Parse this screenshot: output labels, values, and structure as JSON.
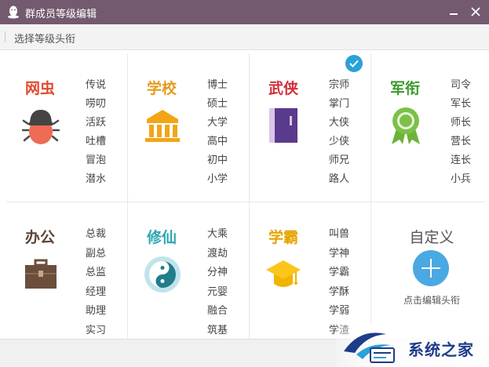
{
  "window": {
    "title": "群成员等级编辑"
  },
  "toolbar": {
    "hint": "选择等级头衔"
  },
  "categories": [
    {
      "name": "网虫",
      "color": "#e04a30",
      "ranks": [
        "传说",
        "唠叨",
        "活跃",
        "吐槽",
        "冒泡",
        "潜水"
      ],
      "selected": false
    },
    {
      "name": "学校",
      "color": "#e69a1c",
      "ranks": [
        "博士",
        "硕士",
        "大学",
        "高中",
        "初中",
        "小学"
      ],
      "selected": false
    },
    {
      "name": "武侠",
      "color": "#d02f3a",
      "ranks": [
        "宗师",
        "掌门",
        "大侠",
        "少侠",
        "师兄",
        "路人"
      ],
      "selected": true
    },
    {
      "name": "军衔",
      "color": "#3a9b2e",
      "ranks": [
        "司令",
        "军长",
        "师长",
        "营长",
        "连长",
        "小兵"
      ],
      "selected": false
    },
    {
      "name": "办公",
      "color": "#5b4436",
      "ranks": [
        "总裁",
        "副总",
        "总监",
        "经理",
        "助理",
        "实习"
      ],
      "selected": false
    },
    {
      "name": "修仙",
      "color": "#2fa6b4",
      "ranks": [
        "大乘",
        "渡劫",
        "分神",
        "元婴",
        "融合",
        "筑基"
      ],
      "selected": false
    },
    {
      "name": "学霸",
      "color": "#e6a400",
      "ranks": [
        "叫兽",
        "学神",
        "学霸",
        "学酥",
        "学弱",
        "学渣"
      ],
      "selected": false
    }
  ],
  "custom": {
    "title": "自定义",
    "subtitle": "点击编辑头衔"
  },
  "watermark": {
    "text": "系统之家"
  }
}
